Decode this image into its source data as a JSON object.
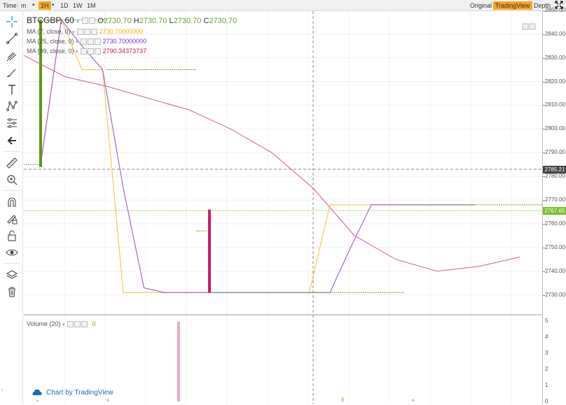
{
  "topbar": {
    "time_label": "Time",
    "interval_prefix": "m",
    "intervals": [
      "1H",
      "1D",
      "1W",
      "1M"
    ],
    "active_interval": "1H",
    "view_original": "Original",
    "view_tradingview": "TradingView",
    "view_depth": "Depth"
  },
  "toolbar": {
    "tools": [
      "crosshair-icon",
      "trend-line-icon",
      "pitchfork-icon",
      "brush-icon",
      "text-icon",
      "pattern-icon",
      "measure-tools-icon",
      "back-arrow-icon",
      "ruler-icon",
      "zoom-in-icon",
      "magnet-icon",
      "lock-drawing-icon",
      "unlock-icon",
      "eye-icon",
      "layers-icon",
      "trash-icon"
    ]
  },
  "legend": {
    "symbol": "BTCGBP, 60",
    "ohlc": {
      "o_label": "O",
      "o": "2730.70",
      "h_label": "H",
      "h": "2730.70",
      "l_label": "L",
      "l": "2730.70",
      "c_label": "C",
      "c": "2730.70"
    },
    "ma1": {
      "label": "MA (7, close, 0)",
      "value": "2730.70000000",
      "color": "#f5b300"
    },
    "ma2": {
      "label": "MA (25, close, 0)",
      "value": "2730.70000000",
      "color": "#7b2fb8"
    },
    "ma3": {
      "label": "MA (99, close, 0)",
      "value": "2790.34373737",
      "color": "#c2185b"
    }
  },
  "volume": {
    "label": "Volume (20)",
    "value": "0"
  },
  "watermark": "Chart by TradingView",
  "chart_data": {
    "type": "line",
    "symbol": "BTCGBP",
    "ylim": [
      2724,
      2852
    ],
    "yticks": [
      2730,
      2740,
      2750,
      2760,
      2770,
      2780,
      2790,
      2800,
      2810,
      2820,
      2830,
      2840,
      2850
    ],
    "price_labels": {
      "crosshair": "2785.21",
      "last": "2767.65"
    },
    "candles": [
      {
        "i": 0,
        "o": 2784,
        "h": 2846,
        "l": 2784,
        "c": 2846,
        "color": "#5a9a14"
      },
      {
        "i": 8,
        "o": 2766,
        "h": 2766,
        "l": 2731,
        "c": 2731,
        "color": "#d0186a"
      }
    ],
    "series": [
      {
        "name": "MA (7, close, 0)",
        "color": "#f5c542",
        "values": [
          2785,
          2846,
          2825,
          2825,
          2731,
          2731,
          2731,
          2731,
          2731,
          2731,
          2731,
          2731,
          2731,
          2731,
          2768,
          2768,
          2768,
          2768,
          2768,
          2768,
          2768,
          2768
        ]
      },
      {
        "name": "MA (25, close, 0)",
        "color": "#9b59d0",
        "values": [
          2785,
          2846,
          2835,
          2825,
          2775,
          2733,
          2731,
          2731,
          2731,
          2731,
          2731,
          2731,
          2731,
          2731,
          2731,
          2750,
          2768,
          2768,
          2768,
          2768,
          2768,
          2768
        ]
      },
      {
        "name": "MA (99, close, 0)",
        "color": "#d06aa8",
        "values": [
          2831,
          2822,
          2818,
          2813,
          2808,
          2800,
          2790,
          2775,
          2755,
          2745,
          2740,
          2742,
          2746
        ]
      }
    ],
    "volume": {
      "ylim": [
        0,
        1
      ],
      "bars": [
        0.02,
        0,
        0,
        0.03,
        0,
        0,
        0.99,
        0,
        0,
        0,
        0,
        0,
        0,
        0.05,
        0,
        0,
        0.03
      ]
    }
  }
}
